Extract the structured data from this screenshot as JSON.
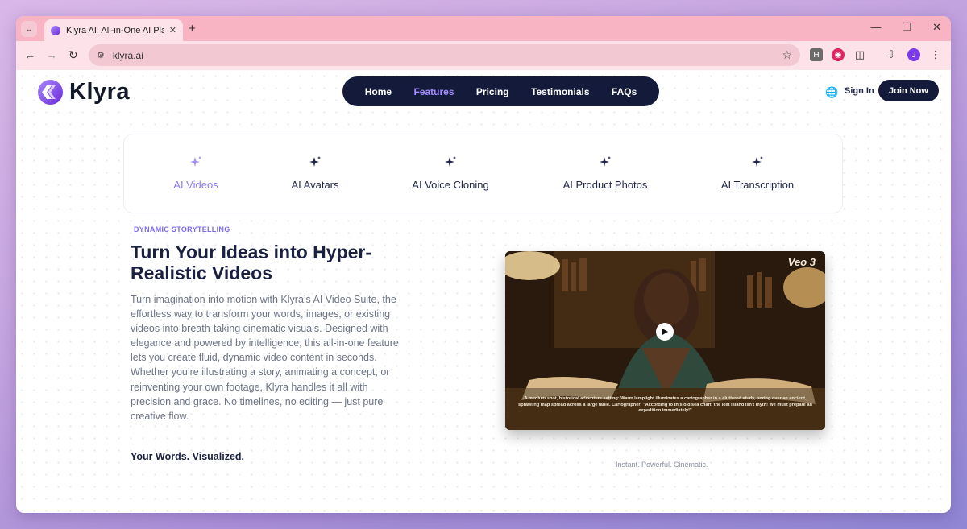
{
  "browser": {
    "tab_title": "Klyra AI: All-in-One AI Platform",
    "url": "klyra.ai",
    "profile_initial": "J",
    "ext_h": "H"
  },
  "site": {
    "brand": "Klyra",
    "nav": [
      "Home",
      "Features",
      "Pricing",
      "Testimonials",
      "FAQs"
    ],
    "active_nav": "Features",
    "sign_in": "Sign In",
    "join_now": "Join Now"
  },
  "features": {
    "tabs": [
      "AI Videos",
      "AI Avatars",
      "AI Voice Cloning",
      "AI Product Photos",
      "AI Transcription"
    ],
    "active": "AI Videos"
  },
  "content": {
    "eyebrow": "DYNAMIC STORYTELLING",
    "headline": "Turn Your Ideas into Hyper-Realistic Videos",
    "body": "Turn imagination into motion with Klyra’s AI Video Suite, the effortless way to transform your words, images, or existing videos into breath-taking cinematic visuals. Designed with elegance and powered by intelligence, this all-in-one feature lets you create fluid, dynamic video content in seconds. Whether you’re illustrating a story, animating a concept, or reinventing your own footage, Klyra handles it all with precision and grace. No timelines, no editing — just pure creative flow.",
    "tagline": "Your Words. Visualized.",
    "video_badge": "Veo 3",
    "video_caption": "A medium shot, historical adventure setting: Warm lamplight illuminates a cartographer in a cluttered study, poring over an ancient, sprawling map spread across a large table. Cartographer: \"According to this old sea chart, the lost island isn't myth! We must prepare an expedition immediately!\"",
    "video_subtitle": "Instant. Powerful. Cinematic."
  },
  "colors": {
    "accent": "#8b7cf0",
    "navy": "#141a3a",
    "tabbar": "#f8b4c2"
  }
}
